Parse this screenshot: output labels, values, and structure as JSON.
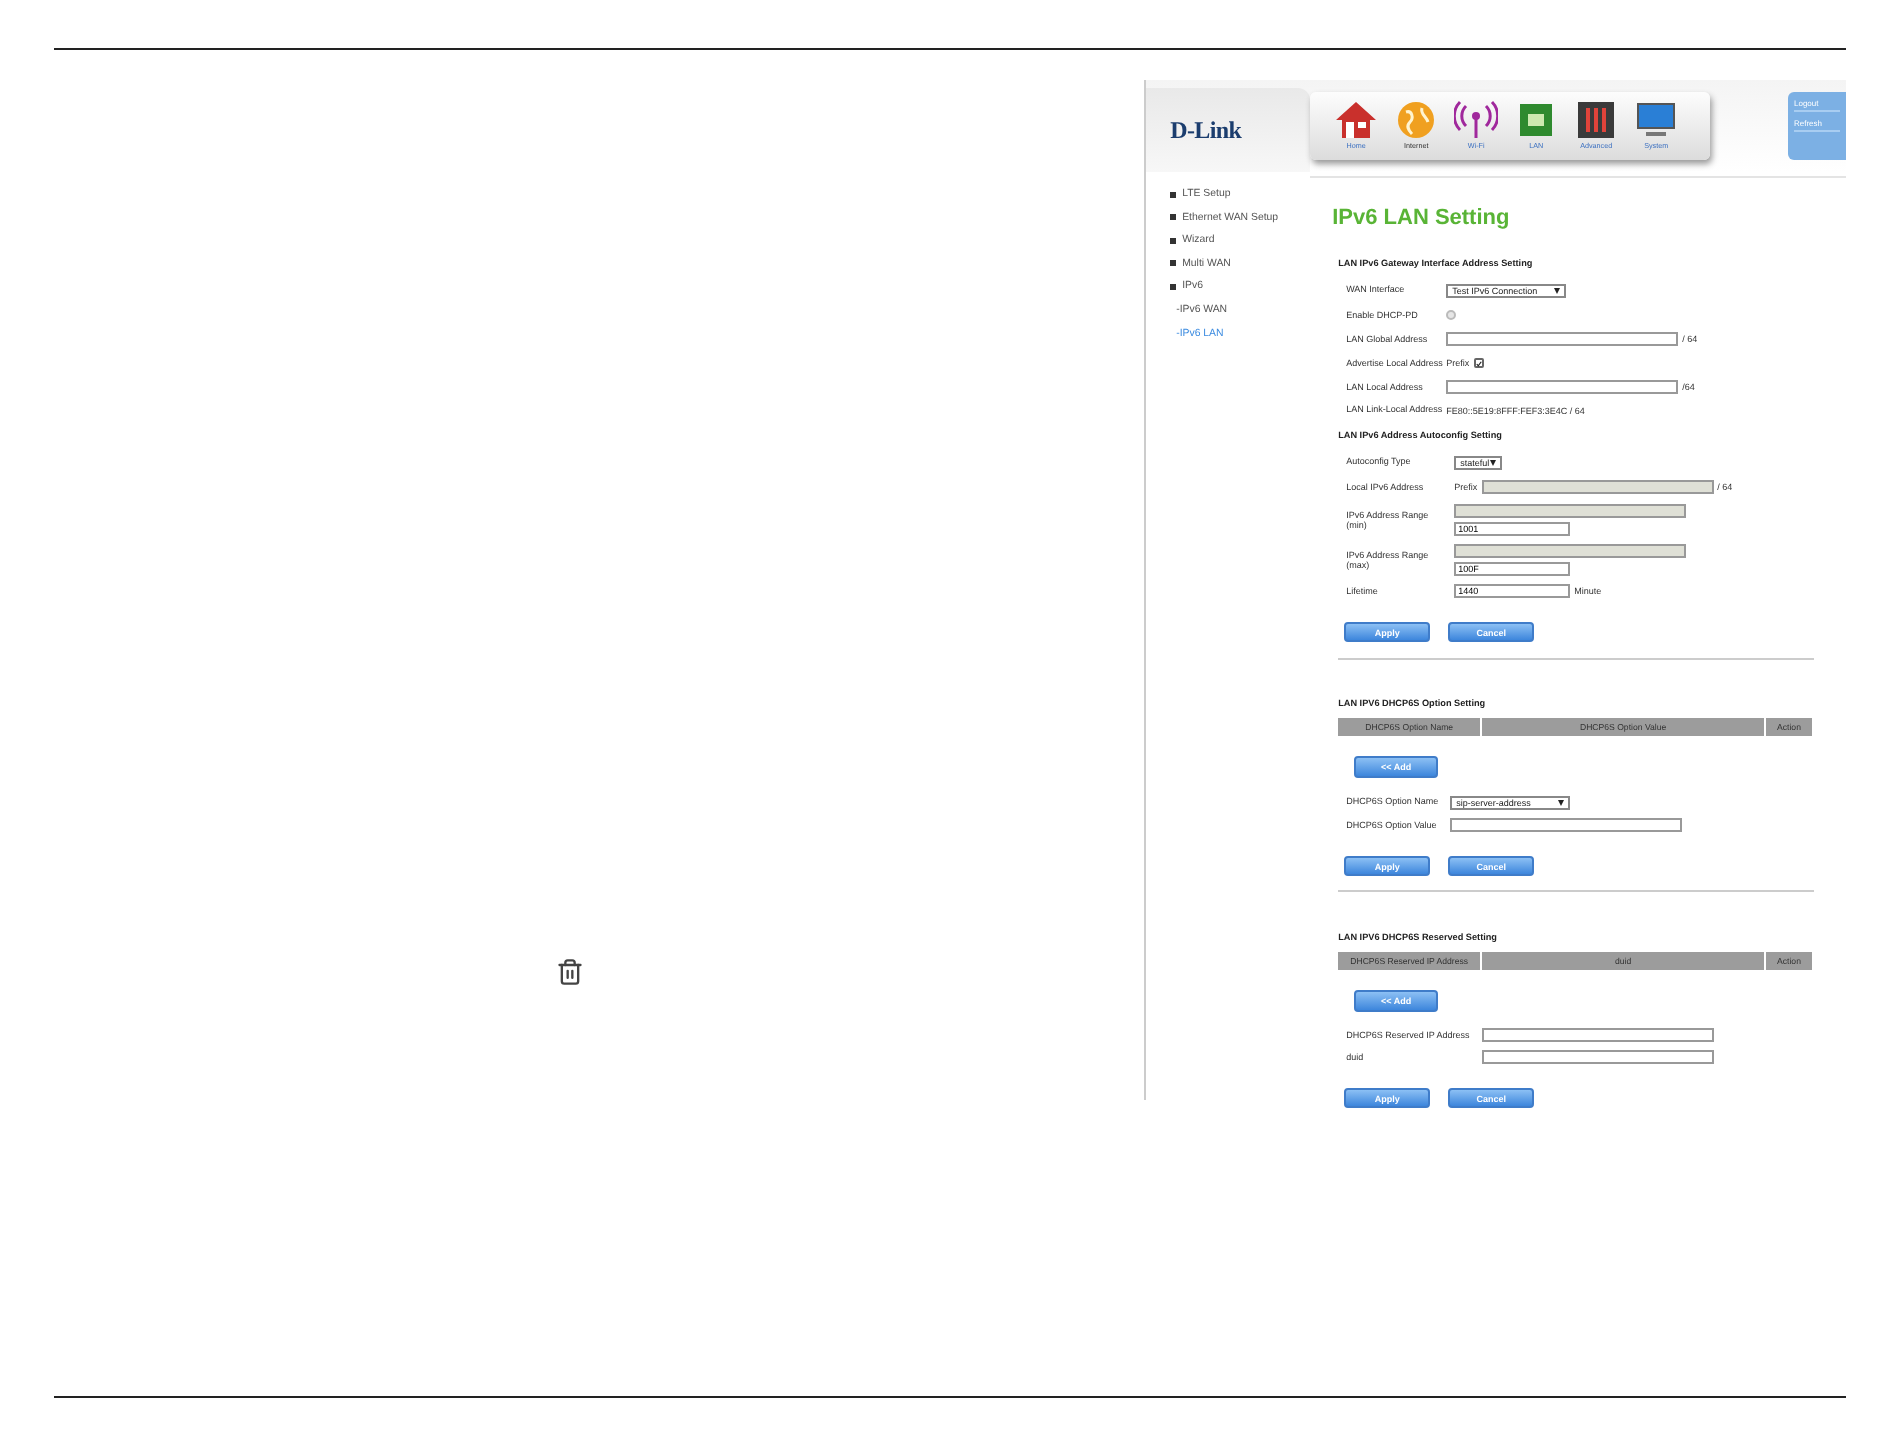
{
  "brand": {
    "logo": "D-Link"
  },
  "nav": [
    {
      "label": "Home",
      "kind": "home",
      "selected": false
    },
    {
      "label": "Internet",
      "kind": "globe",
      "selected": true
    },
    {
      "label": "Wi-Fi",
      "kind": "wifi",
      "selected": false
    },
    {
      "label": "LAN",
      "kind": "lan",
      "selected": false
    },
    {
      "label": "Advanced",
      "kind": "tools",
      "selected": false
    },
    {
      "label": "System",
      "kind": "monitor",
      "selected": false
    }
  ],
  "account_links": [
    "Logout",
    "Refresh"
  ],
  "sidebar": {
    "items": [
      {
        "label": "LTE Setup",
        "selected": false
      },
      {
        "label": "Ethernet WAN Setup",
        "selected": false
      },
      {
        "label": "Wizard",
        "selected": false
      },
      {
        "label": "Multi WAN",
        "selected": false
      },
      {
        "label": "IPv6",
        "selected": false,
        "children": [
          {
            "label": "-IPv6 WAN",
            "selected": false
          },
          {
            "label": "-IPv6 LAN",
            "selected": true
          }
        ]
      }
    ]
  },
  "page_title": "IPv6 LAN Setting",
  "sections": [
    {
      "heading": "LAN IPv6 Gateway Interface Address Setting",
      "rows": [
        {
          "kind": "select",
          "label": "WAN Interface",
          "value": "Test IPv6 Connection"
        },
        {
          "kind": "checkbox",
          "label": "Enable DHCP-PD",
          "checked": false,
          "disabled": true
        },
        {
          "kind": "input",
          "label": "LAN Global Address",
          "value": "",
          "suffix": "/ 64"
        },
        {
          "kind": "checkbox",
          "label": "Advertise Local Address",
          "prefix": "Prefix",
          "checked": true,
          "disabled": false
        },
        {
          "kind": "input",
          "label": "LAN Local Address",
          "value": "",
          "suffix": "/64"
        },
        {
          "kind": "text",
          "label": "LAN Link-Local Address",
          "value": "FE80::5E19:8FFF:FEF3:3E4C / 64"
        }
      ]
    },
    {
      "heading": "LAN IPv6 Address Autoconfig Setting",
      "rows": [
        {
          "kind": "select",
          "label": "Autoconfig Type",
          "value": "stateful"
        },
        {
          "kind": "prefix",
          "label": "Local IPv6 Address",
          "prefix": "Prefix",
          "suffix": "/ 64"
        },
        {
          "kind": "range",
          "label": "IPv6 Address Range (min)",
          "value": "1001"
        },
        {
          "kind": "range",
          "label": "IPv6 Address Range (max)",
          "value": "100F"
        },
        {
          "kind": "input",
          "label": "Lifetime",
          "value": "1440",
          "suffix": "Minute"
        }
      ],
      "buttons": [
        "Apply",
        "Cancel"
      ]
    },
    {
      "heading": "LAN IPV6 DHCP6S Option Setting",
      "columns": [
        "DHCP6S Option Name",
        "DHCP6S Option Value",
        "Action"
      ],
      "add_button": "<< Add",
      "rows": [
        {
          "kind": "select",
          "label": "DHCP6S Option Name",
          "value": "sip-server-address"
        },
        {
          "kind": "input",
          "label": "DHCP6S Option Value",
          "value": ""
        }
      ],
      "buttons": [
        "Apply",
        "Cancel"
      ]
    },
    {
      "heading": "LAN IPV6 DHCP6S Reserved Setting",
      "columns": [
        "DHCP6S Reserved IP Address",
        "duid",
        "Action"
      ],
      "add_button": "<< Add",
      "rows": [
        {
          "kind": "input",
          "label": "DHCP6S Reserved IP Address",
          "value": ""
        },
        {
          "kind": "input",
          "label": "duid",
          "value": ""
        }
      ],
      "buttons": [
        "Apply",
        "Cancel"
      ]
    }
  ]
}
